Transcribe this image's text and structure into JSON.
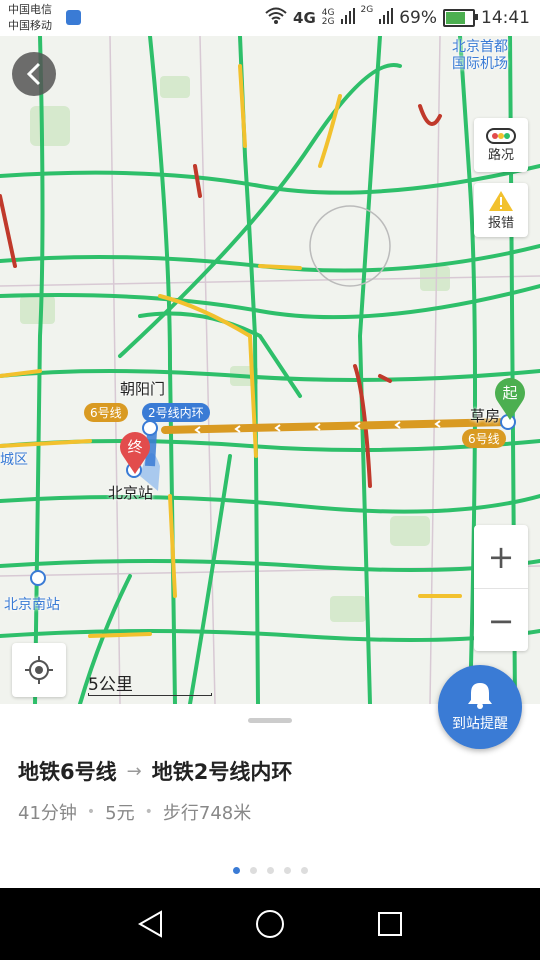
{
  "status_bar": {
    "carrier_1": "中国电信",
    "carrier_2": "中国移动",
    "net_1": "4G",
    "net_2": "4G",
    "net_3": "2G",
    "battery": "69%",
    "time": "14:41"
  },
  "map": {
    "labels": {
      "airport_1": "北京首都",
      "airport_2": "国际机场",
      "chaoyangmen": "朝阳门",
      "caofang": "草房",
      "beijing_station": "北京站",
      "dongcheng": "城区",
      "beijing_south": "北京南站"
    },
    "line_tags": {
      "line6_left": "6号线",
      "line2_inner": "2号线内环",
      "line6_right": "6号线"
    },
    "markers": {
      "start": "起",
      "end": "终"
    },
    "scale": "5公里",
    "colors": {
      "traffic_green": "#2ebf6a",
      "traffic_yellow": "#f2c12e",
      "traffic_red": "#c0392b",
      "route": "#d99a22",
      "accent": "#3a7bd5"
    }
  },
  "controls": {
    "traffic_label": "路况",
    "report_label": "报错",
    "zoom_in": "+",
    "zoom_out": "−",
    "arrive_alert": "到站提醒"
  },
  "route": {
    "from": "地铁6号线",
    "to": "地铁2号线内环",
    "duration": "41分钟",
    "price": "5元",
    "walk": "步行748米"
  },
  "pager": {
    "total": 5,
    "active": 1
  }
}
